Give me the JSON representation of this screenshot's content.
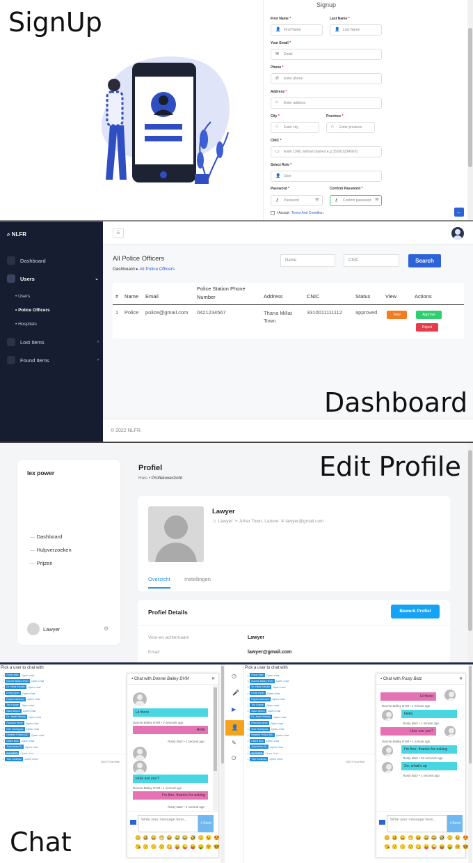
{
  "signup": {
    "caption": "SignUp",
    "form_title": "Signup",
    "first_name": {
      "label": "First Name",
      "placeholder": "First Name"
    },
    "last_name": {
      "label": "Last Name",
      "placeholder": "Last Name"
    },
    "email": {
      "label": "Your Email",
      "placeholder": "Email"
    },
    "phone": {
      "label": "Phone",
      "placeholder": "Enter phone"
    },
    "address": {
      "label": "Address",
      "placeholder": "Enter address"
    },
    "city": {
      "label": "City",
      "placeholder": "Enter city"
    },
    "province": {
      "label": "Province",
      "placeholder": "Enter province"
    },
    "cnic": {
      "label": "CNIC",
      "placeholder": "Enter CNIC without dashes e.g 3310012345670"
    },
    "role": {
      "label": "Select Role",
      "value": "User"
    },
    "password": {
      "label": "Password",
      "placeholder": "Password"
    },
    "confirm_password": {
      "label": "Confirm Password",
      "placeholder": "Confirm password"
    },
    "accept_text": "I Accept",
    "terms_link": "Terms And Condition",
    "required_mark": "*"
  },
  "dashboard": {
    "caption": "Dashboard",
    "brand": "NLFR",
    "sidebar": {
      "dashboard": "Dashboard",
      "users": "Users",
      "users_sub": [
        "Users",
        "Police Officers",
        "Hospitals"
      ],
      "lost_items": "Lost Items",
      "found_items": "Found Items"
    },
    "page_title": "All Police Officers",
    "breadcrumb": {
      "home": "Dashboard",
      "current": "All Police Officers"
    },
    "search": {
      "name_placeholder": "Name",
      "cnic_placeholder": "CNIC",
      "button": "Search"
    },
    "table": {
      "headers": [
        "#",
        "Name",
        "Email",
        "Police Station Phone Number",
        "Address",
        "CNIC",
        "Status",
        "View",
        "Actions"
      ],
      "rows": [
        {
          "num": "1",
          "name": "Police",
          "email": "police@gmail.com",
          "phone": "0421234567",
          "address": "Thana Millat Town",
          "cnic": "3310011111112",
          "status": "approved",
          "view": "View",
          "approve": "Approve",
          "reject": "Reject"
        }
      ]
    },
    "footer": "© 2022 NLFR."
  },
  "profile": {
    "caption": "Edit Profile",
    "sidebar_user": "lex power",
    "menu": [
      "Dashboard",
      "Hulpverzoeken",
      "Prijzen"
    ],
    "bottom_user": "Lawyer",
    "title": "Profiel",
    "breadcrumb": {
      "home": "Huis",
      "current": "Profieloverzicht"
    },
    "name": "Lawyer",
    "role": "Lawyer",
    "location": "Johar Town, Lahore",
    "email": "lawyer@gmail.com",
    "tabs": [
      "Overzicht",
      "Instellingen"
    ],
    "details_title": "Profiel Details",
    "edit_button": "Bewerk Profiel",
    "fields": [
      {
        "label": "Voor-en achternaam",
        "value": "Lawyer"
      },
      {
        "label": "Email",
        "value": "lawyer@gmail.com"
      }
    ]
  },
  "chat": {
    "caption": "Chat",
    "pick_text": "Pick a user to chat with",
    "open_chat": "Open chat",
    "users": [
      "Rusty Batz",
      "Donnie Bailey DVM",
      "Dr. Hilda Schultz",
      "Emily Ryan",
      "Kayla Hartmann",
      "Tito Hoppe",
      "Nash Ullrich",
      "Dr. Jewel Wisoky",
      "Rhianna Mertz",
      "Orie Rodriguez",
      "Heather Fritsch MD",
      "Elbert Bins",
      "Zora Mertz Sr.",
      "Ivy Kohler",
      "Tom Kuhlman"
    ],
    "footer": "2022 © Sun Web",
    "send": "Send",
    "input_placeholder": "Write your message here...",
    "emoji_row1": "😊😃😄😁😆😅😂🤣🙂😉😍",
    "emoji_row2": "😘😗😙😚😋😛😜😝🤑🤗🤓",
    "left": {
      "header_prefix": "Chat with",
      "header_name": "Donnie Bailey DVM",
      "messages": [
        {
          "text": "Hi there",
          "meta": "Donnie Bailey DVM • 2 seconds ago"
        },
        {
          "text": "Hello",
          "meta": "Rusty Batz • 1 second ago"
        },
        {
          "text": "How are you?",
          "meta": "Donnie Bailey DVM • 1 second ago"
        },
        {
          "text": "I'm fine, thanks for asking",
          "meta": "Rusty Batz • 1 second ago"
        }
      ]
    },
    "right": {
      "header_prefix": "Chat with",
      "header_name": "Rusty Batz",
      "messages": [
        {
          "text": "Hi there",
          "meta": "Donnie Bailey DVM • 1 minute ago"
        },
        {
          "text": "Hello",
          "meta": "Rusty Batz • 1 minute ago"
        },
        {
          "text": "How are you?",
          "meta": "Donnie Bailey DVM • 1 minute ago"
        },
        {
          "text": "I'm fine, thanks for asking",
          "meta": "Rusty Batz • 53 seconds ago"
        },
        {
          "text": "So, what's up",
          "meta": "Rusty Batz • 1 second ago"
        }
      ]
    }
  },
  "colors": {
    "primary": "#2d63d8",
    "sidebar_bg": "#161d31",
    "pink": "#e573b4",
    "cyan": "#48d6e3",
    "approve": "#2ecf6e",
    "reject": "#e53b4a",
    "view": "#f47b20"
  }
}
